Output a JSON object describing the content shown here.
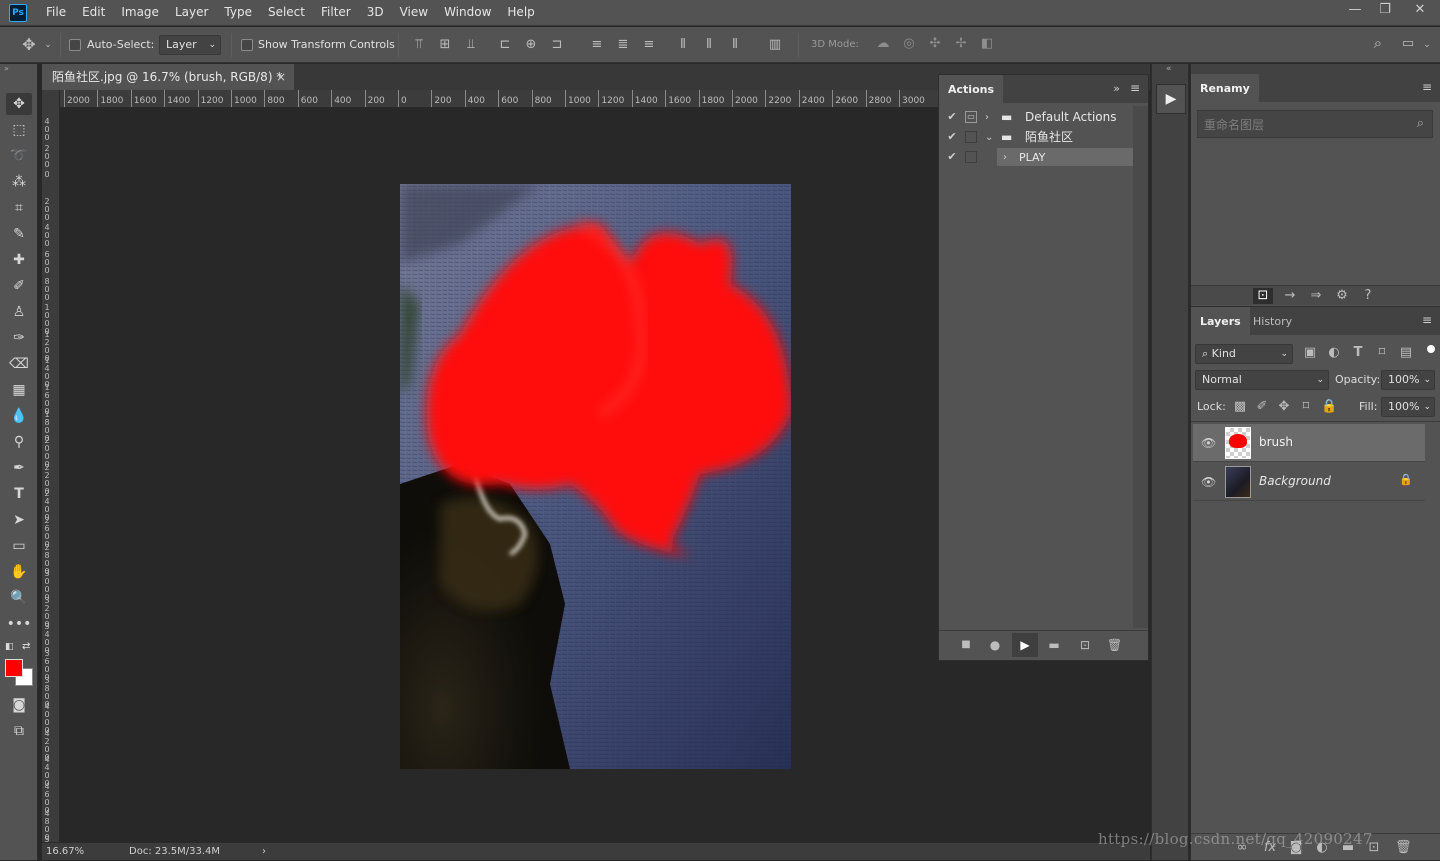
{
  "app": {
    "logo": "Ps"
  },
  "menu": [
    "File",
    "Edit",
    "Image",
    "Layer",
    "Type",
    "Select",
    "Filter",
    "3D",
    "View",
    "Window",
    "Help"
  ],
  "window_controls": {
    "minimize": "—",
    "restore": "❐",
    "close": "✕"
  },
  "options": {
    "auto_select_label": "Auto-Select:",
    "auto_select_value": "Layer",
    "show_transform_label": "Show Transform Controls",
    "mode_3d_label": "3D Mode:"
  },
  "document": {
    "tab_title": "陌鱼社区.jpg @ 16.7% (brush, RGB/8) *",
    "close": "×"
  },
  "rulers": {
    "h_ticks": [
      "2000",
      "1800",
      "1600",
      "1400",
      "1200",
      "1000",
      "800",
      "600",
      "400",
      "200",
      "0",
      "200",
      "400",
      "600",
      "800",
      "1000",
      "1200",
      "1400",
      "1600",
      "1800",
      "2000",
      "2200",
      "2400",
      "2600",
      "2800",
      "3000"
    ],
    "v_ticks": [
      "400",
      "200",
      "0",
      "200",
      "400",
      "600",
      "800",
      "1000",
      "1200",
      "1400",
      "1600",
      "1800",
      "2000",
      "2200",
      "2400",
      "2600",
      "2800",
      "3000",
      "3200",
      "3400",
      "3600",
      "3800",
      "4000",
      "4200",
      "4400",
      "4600",
      "4800",
      "5000"
    ]
  },
  "status": {
    "zoom": "16.67%",
    "doc": "Doc: 23.5M/33.4M",
    "arrow": "›"
  },
  "colors": {
    "foreground": "#ff0000",
    "background": "#ffffff",
    "accent": "#31a8ff"
  },
  "actions_panel": {
    "tab": "Actions",
    "rows": [
      {
        "name": "Default Actions",
        "checked": true
      },
      {
        "name": "陌鱼社区",
        "checked": true
      },
      {
        "name": "PLAY",
        "checked": true
      }
    ]
  },
  "renamy_panel": {
    "tab": "Renamy",
    "search_placeholder": "重命名图层"
  },
  "layers_panel": {
    "tabs": [
      "Layers",
      "History"
    ],
    "filter_label": "Kind",
    "blend_mode": "Normal",
    "opacity_label": "Opacity:",
    "opacity_value": "100%",
    "lock_label": "Lock:",
    "fill_label": "Fill:",
    "fill_value": "100%",
    "layers": [
      {
        "name": "brush",
        "selected": true,
        "visible": true
      },
      {
        "name": "Background",
        "selected": false,
        "visible": true,
        "locked": true
      }
    ]
  },
  "watermark": "https://blog.csdn.net/qq_42090247"
}
